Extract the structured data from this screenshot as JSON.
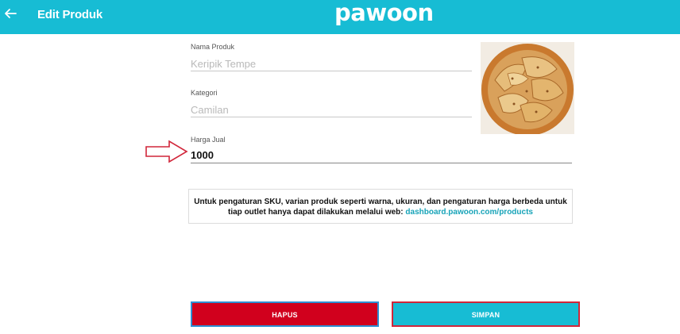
{
  "header": {
    "title": "Edit Produk",
    "logo": "pawoon",
    "back_icon": "arrow-left-icon",
    "background": "#17bcd4"
  },
  "form": {
    "name": {
      "label": "Nama Produk",
      "value": "Keripik Tempe"
    },
    "category": {
      "label": "Kategori",
      "value": "Camilan"
    },
    "price": {
      "label": "Harga Jual",
      "value": "1000"
    }
  },
  "info": {
    "text": "Untuk pengaturan SKU, varian produk seperti warna, ukuran, dan pengaturan harga berbeda untuk tiap outlet hanya dapat dilakukan melalui web: ",
    "link": "dashboard.pawoon.com/products"
  },
  "actions": {
    "delete_label": "HAPUS",
    "save_label": "SIMPAN",
    "delete_color": "#d1001d",
    "save_color": "#17bcd4"
  }
}
